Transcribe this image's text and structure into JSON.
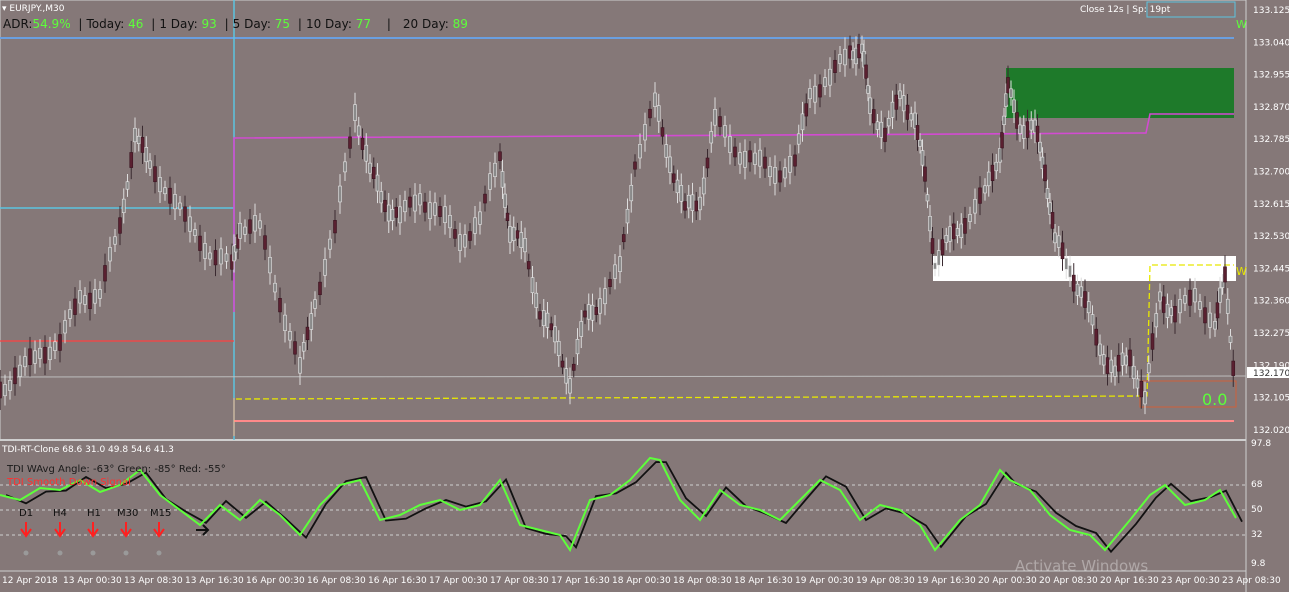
{
  "symbol_bar": {
    "menu_icon": "dropdown-triangle-icon",
    "symbol": "EURJPY.,M30"
  },
  "adr": {
    "label_adr": "ADR:",
    "adr_value": "54.9%",
    "label_today": "Today:",
    "today": "46",
    "label_1d": "1 Day:",
    "d1": "93",
    "label_5d": "5 Day:",
    "d5": "75",
    "label_10d": "10 Day:",
    "d10": "77",
    "label_20d": "20 Day:",
    "d20": "89"
  },
  "close_info": "Close 12s | Sp: 19pt",
  "price_axis": [
    "133.125",
    "133.040",
    "132.955",
    "132.870",
    "132.785",
    "132.700",
    "132.615",
    "132.530",
    "132.445",
    "132.360",
    "132.275",
    "132.190",
    "132.105",
    "132.020"
  ],
  "current_price": "132.170",
  "tdi_counter": "0.0",
  "zone_labels": {
    "top_right": "W",
    "mid_right": "W"
  },
  "indicator": {
    "title": "TDI-RT-Clone 68.6 31.0 49.8 54.6 41.3",
    "angle_text": "TDI WAvg Angle: -63°  Green: -85°  Red: -55°",
    "red_text": "TDI Smooth Down Signal",
    "timeframes": [
      "D1",
      "H4",
      "H1",
      "M30",
      "M15"
    ],
    "levels": [
      "97.8",
      "68",
      "50",
      "32",
      "9.8"
    ]
  },
  "time_axis": [
    "12 Apr 2018",
    "13 Apr 00:30",
    "13 Apr 08:30",
    "13 Apr 16:30",
    "16 Apr 00:30",
    "16 Apr 08:30",
    "16 Apr 16:30",
    "17 Apr 00:30",
    "17 Apr 08:30",
    "17 Apr 16:30",
    "18 Apr 00:30",
    "18 Apr 08:30",
    "18 Apr 16:30",
    "19 Apr 00:30",
    "19 Apr 08:30",
    "19 Apr 16:30",
    "20 Apr 00:30",
    "20 Apr 08:30",
    "20 Apr 16:30",
    "23 Apr 00:30",
    "23 Apr 08:30"
  ],
  "watermark": "Activate Windows",
  "colors": {
    "background": "#857878",
    "green_zone": "#1e7a2a",
    "white_zone": "#ffffff",
    "blue_line": "#6a9fe0",
    "magenta_line": "#d24bd2",
    "red_line": "#ff5a5a",
    "yellow_line": "#e8e800",
    "tdi_green": "#5dff3a",
    "tdi_black": "#111111"
  }
}
